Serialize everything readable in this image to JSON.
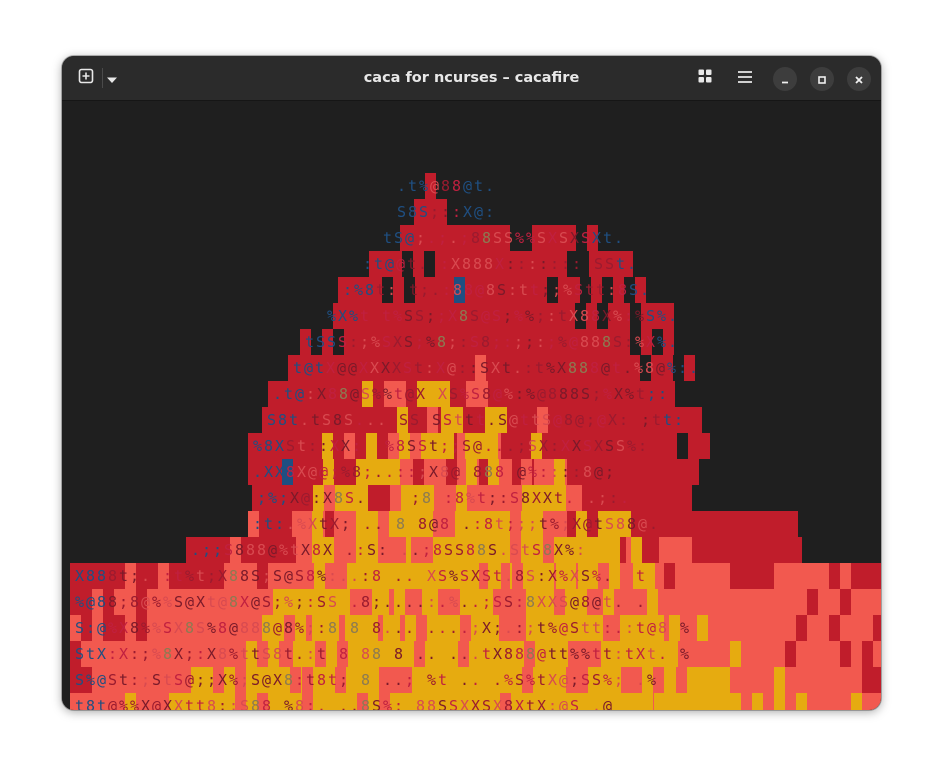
{
  "window": {
    "title": "caca for ncurses – cacafire",
    "buttons": {
      "new_tab": "new-tab-icon",
      "tab_menu": "chevron-down-icon",
      "grid_view": "grid-icon",
      "main_menu": "hamburger-menu-icon",
      "minimize": "minimize-icon",
      "maximize": "maximize-icon",
      "close": "close-icon"
    }
  },
  "terminal": {
    "background": "#1e1e1e",
    "palette": {
      "dark_red": "#c01d2b",
      "salmon": "#f2594f",
      "amber": "#e6ab10",
      "blue": "#1f4f82",
      "olive": "#8c7a52"
    },
    "lines": [
      ".t%@88@t.",
      "S8S;::X@:",
      "tS@;.;.;88SS%%SXSXSXt.",
      ":t@@t. :X888X::::::: SSt.",
      ":%8t: t;.:88@8S:tt;;%Stt:8S.",
      "%X%t t%SS;;X8S@S;%%;:tX88X%:%S%.",
      "tSSS:;%SXS;%8;:S8;:;;:;%@888S:%X%.",
      "t@tX@@XXXXSt:X@::SXt.:t%X888@t.%8@%:.",
      ".t@:X88@S%%t@X XS%S8@%:%@888S;%X%t;:",
      "S8t.tS8S... SS SSttt.S@ttS@8@;@X: ;tt:",
      "%8XSt::XX:  %8SSt;;S@...;SX:XXSXSS%:",
      ".XX8X@@;%8;..::;X8@ 888 @%::::8@;",
      ";%;X@:X8S.    ;8 :8%t;:S8XXt. .;:.",
      ":t:.%XtX; .. 8 8@8 .:8t;;;t%;X@tS88@.",
      ".;;S888@%tX8X .:S: ..;8SS88S.StS8X%:",
      "X888t;. :t%t;X88S;S@S8%:..:8 .. XS%SXSt.8S:X%XS%.  t",
      "%@88;8@%%S@Xt@8X@S;%;:SS .8;....:.%..;SS:8XXS@8@t. .",
      "S:@%X8%%SX8S%8@888@8%;:8 8 8... ....;X;.:;t%@Stt:.:t@8 %",
      "StX:X:;%8X;:X8%ttS8t.:t 8 88 8 .. ...tX888@tt%%tt:tXt. %",
      "S%@St:;StS@;;X%;S@X8:t8t; 8 ..; %t .. .%S%tX@;SS%; .%",
      "t8t@%%X@XXtt8;;S88 %8:. ..8S%: 88SSXXSX8XtX;@S .@"
    ]
  }
}
